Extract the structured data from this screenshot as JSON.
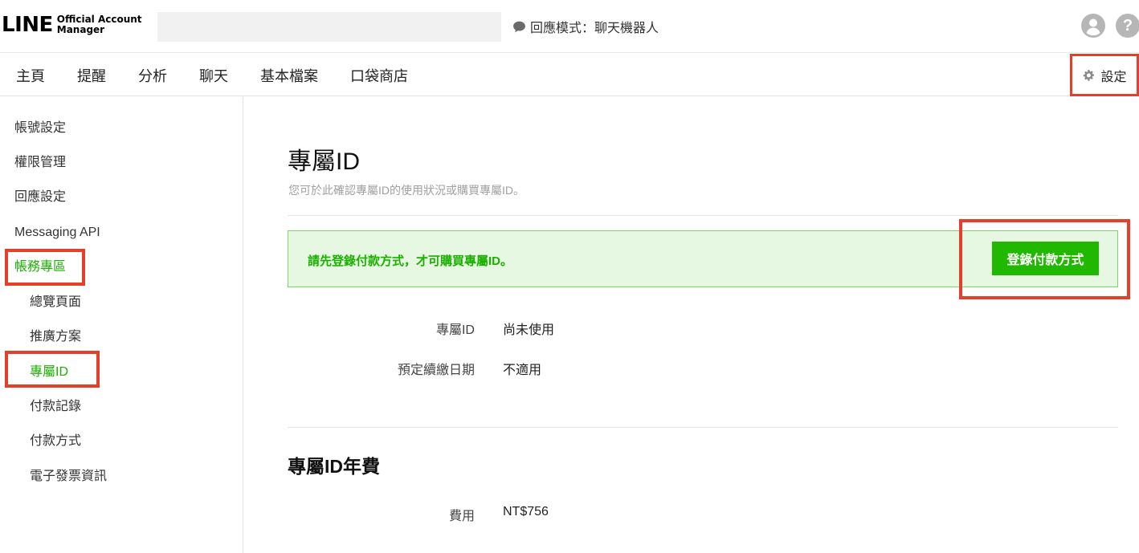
{
  "header": {
    "logo_main": "LINE",
    "logo_line1": "Official Account",
    "logo_line2": "Manager",
    "mode_text": "回應模式：聊天機器人"
  },
  "nav": {
    "items": [
      "主頁",
      "提醒",
      "分析",
      "聊天",
      "基本檔案",
      "口袋商店"
    ],
    "settings_label": "設定"
  },
  "sidebar": {
    "items": [
      {
        "label": "帳號設定"
      },
      {
        "label": "權限管理"
      },
      {
        "label": "回應設定"
      },
      {
        "label": "Messaging API"
      },
      {
        "label": "帳務專區"
      },
      {
        "label": "總覽頁面"
      },
      {
        "label": "推廣方案"
      },
      {
        "label": "專屬ID"
      },
      {
        "label": "付款記錄"
      },
      {
        "label": "付款方式"
      },
      {
        "label": "電子發票資訊"
      }
    ]
  },
  "main": {
    "title": "專屬ID",
    "description": "您可於此確認專屬ID的使用狀況或購買專屬ID。",
    "notice_text": "請先登錄付款方式，才可購買專屬ID。",
    "notice_button": "登錄付款方式",
    "info": [
      {
        "label": "專屬ID",
        "value": "尚未使用"
      },
      {
        "label": "預定續繳日期",
        "value": "不適用"
      }
    ],
    "fee_section_title": "專屬ID年費",
    "fee": {
      "label": "費用",
      "value": "NT$756"
    }
  },
  "colors": {
    "accent_green": "#20b900",
    "active_text": "#1ab000",
    "notice_bg": "#e6f8e1",
    "highlight_red": "#e53e2b"
  },
  "icons": {
    "mode": "chat-bubble-icon",
    "user": "user-avatar-icon",
    "help": "help-icon",
    "settings": "gear-icon"
  }
}
